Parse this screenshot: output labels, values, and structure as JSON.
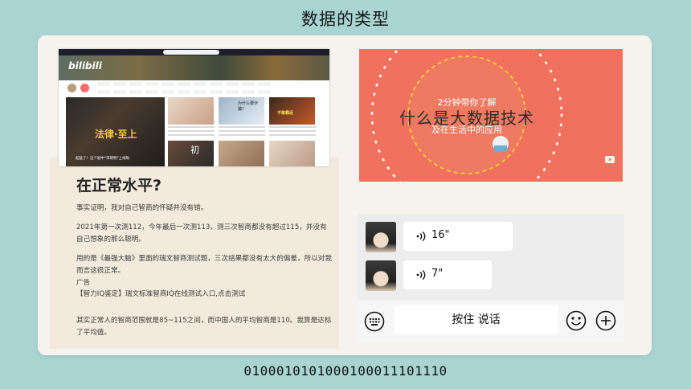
{
  "slide": {
    "title": "数据的类型",
    "binary": "0100010101000100011101110"
  },
  "article": {
    "heading": "在正常水平?",
    "paragraphs": [
      "事实证明，我对自己智商的怀疑并没有错。",
      "2021年第一次测112，今年最后一次测113，测三次智商都没有超过115，并没有自己想象的那么聪明。",
      "用的是《最强大脑》里面的瑞文智商测试题，三次结果都没有太大的偏差，所以对我而言这很正常。",
      "广告",
      "【智力IQ鉴定】瑞文标准智商IQ在线测试入口,点击测试",
      "其实正常人的智商范围就是85~115之间，而中国人的平均智商是110。我算是达标了平均值。"
    ]
  },
  "website": {
    "logo": "bilibili",
    "carousel_title": "法律·至上",
    "carousel_caption": "起猛了！这个剧中\"李明明\"上线啦",
    "thumbs": [
      {
        "text": "初"
      },
      {
        "text": "为什么要诈骗？"
      },
      {
        "text": "不敢靠近"
      }
    ]
  },
  "video": {
    "line1": "2分钟带你了解",
    "line2": "什么是大数据技术",
    "line3": "及在生活中的应用",
    "accent_color": "#f0715d",
    "ring_color": "#f5c542"
  },
  "chat": {
    "messages": [
      {
        "duration": "16\""
      },
      {
        "duration": "7\""
      }
    ],
    "hold_to_talk": "按住 说话"
  }
}
